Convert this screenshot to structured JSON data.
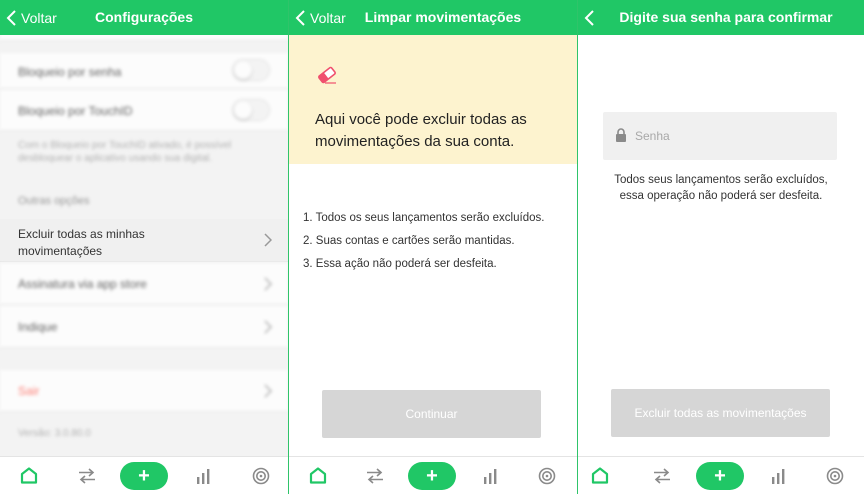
{
  "colors": {
    "brand_green": "#20c766",
    "yellow_panel": "#fdf3cf",
    "disabled_button": "#d6d6d6"
  },
  "panel1": {
    "back_label": "Voltar",
    "title": "Configurações",
    "settings": {
      "lock_password_label": "Bloqueio por senha",
      "lock_touchid_label": "Bloqueio por TouchID",
      "lock_help_text": "Com o Bloqueio por TouchID ativado, é possível desbloquear o aplicativo usando sua digital.",
      "other_options_title": "Outras opções",
      "delete_all_label": "Excluir todas as minhas movimentações",
      "subscription_label": "Assinatura via app store",
      "referral_label": "Indique",
      "logout_label": "Sair",
      "version_label": "Versão: 3.0.80.0"
    }
  },
  "panel2": {
    "back_label": "Voltar",
    "title": "Limpar movimentações",
    "icon": "eraser-icon",
    "intro": "Aqui você pode excluir todas as movimentações da sua conta.",
    "steps": [
      "1. Todos os seus lançamentos serão excluídos.",
      "2. Suas contas e cartões serão mantidas.",
      "3. Essa ação não poderá ser desfeita."
    ],
    "continue_label": "Continuar"
  },
  "panel3": {
    "title": "Digite sua senha para confirmar",
    "password_placeholder": "Senha",
    "warning": "Todos seus lançamentos serão excluídos, essa operação não poderá ser desfeita.",
    "confirm_label": "Excluir todas as movimentações"
  },
  "tabbar": {
    "tabs": [
      "home-icon",
      "transfer-icon",
      "plus-icon",
      "chart-icon",
      "target-icon"
    ],
    "plus_label": "+"
  }
}
